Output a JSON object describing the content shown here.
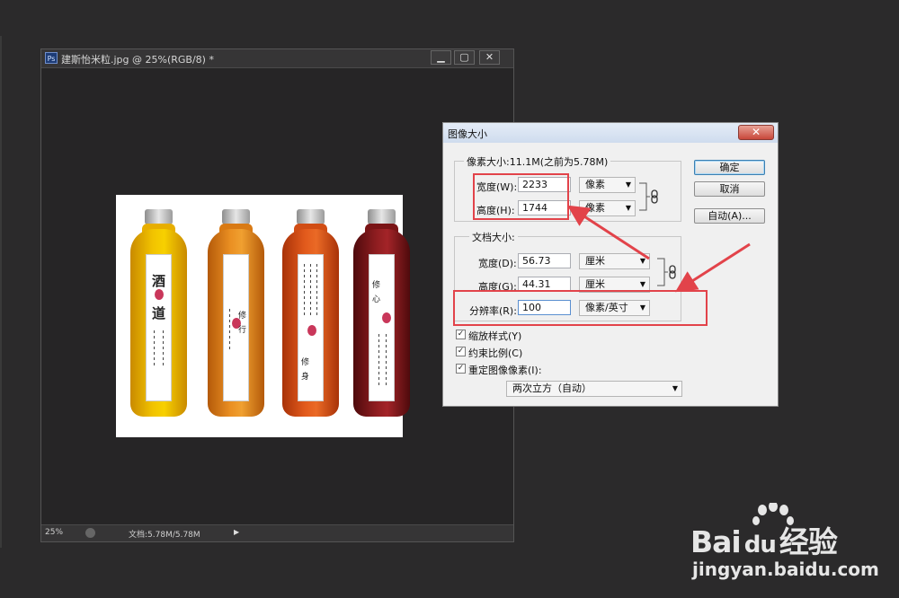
{
  "document": {
    "title": "建斯怡米粒.jpg @ 25%(RGB/8) *",
    "ps_badge": "Ps",
    "window_buttons": [
      "▁",
      "▢",
      "✕"
    ],
    "status": {
      "zoom": "25%",
      "info": "文档:5.78M/5.78M"
    },
    "bottles": [
      {
        "color": "#e8b000",
        "label_main": [
          "酒",
          "道"
        ],
        "label_side": "栖神 聚气 修身 养性"
      },
      {
        "color": "#e0841c",
        "label_main": [
          "修",
          "行"
        ]
      },
      {
        "color": "#d8541a",
        "label_main": [
          "修",
          "身"
        ]
      },
      {
        "color": "#8a1a1c",
        "label_main": [
          "修",
          "心"
        ]
      }
    ]
  },
  "dialog": {
    "title": "图像大小",
    "close": "✕",
    "pixel_group": {
      "title": "像素大小:11.1M(之前为5.78M)",
      "width_label": "宽度(W):",
      "width_value": "2233",
      "width_unit": "像素",
      "height_label": "高度(H):",
      "height_value": "1744",
      "height_unit": "像素"
    },
    "doc_group": {
      "title": "文档大小:",
      "width_label": "宽度(D):",
      "width_value": "56.73",
      "width_unit": "厘米",
      "height_label": "高度(G):",
      "height_value": "44.31",
      "height_unit": "厘米",
      "res_label": "分辨率(R):",
      "res_value": "100",
      "res_unit": "像素/英寸"
    },
    "checkboxes": [
      {
        "label": "缩放样式(Y)",
        "checked": true
      },
      {
        "label": "约束比例(C)",
        "checked": true
      },
      {
        "label": "重定图像像素(I):",
        "checked": true
      }
    ],
    "resample": "两次立方（自动）",
    "buttons": {
      "ok": "确定",
      "cancel": "取消",
      "auto": "自动(A)..."
    }
  },
  "watermark": {
    "brand": "Bai",
    "brand2": "经验",
    "url": "jingyan.baidu.com"
  }
}
